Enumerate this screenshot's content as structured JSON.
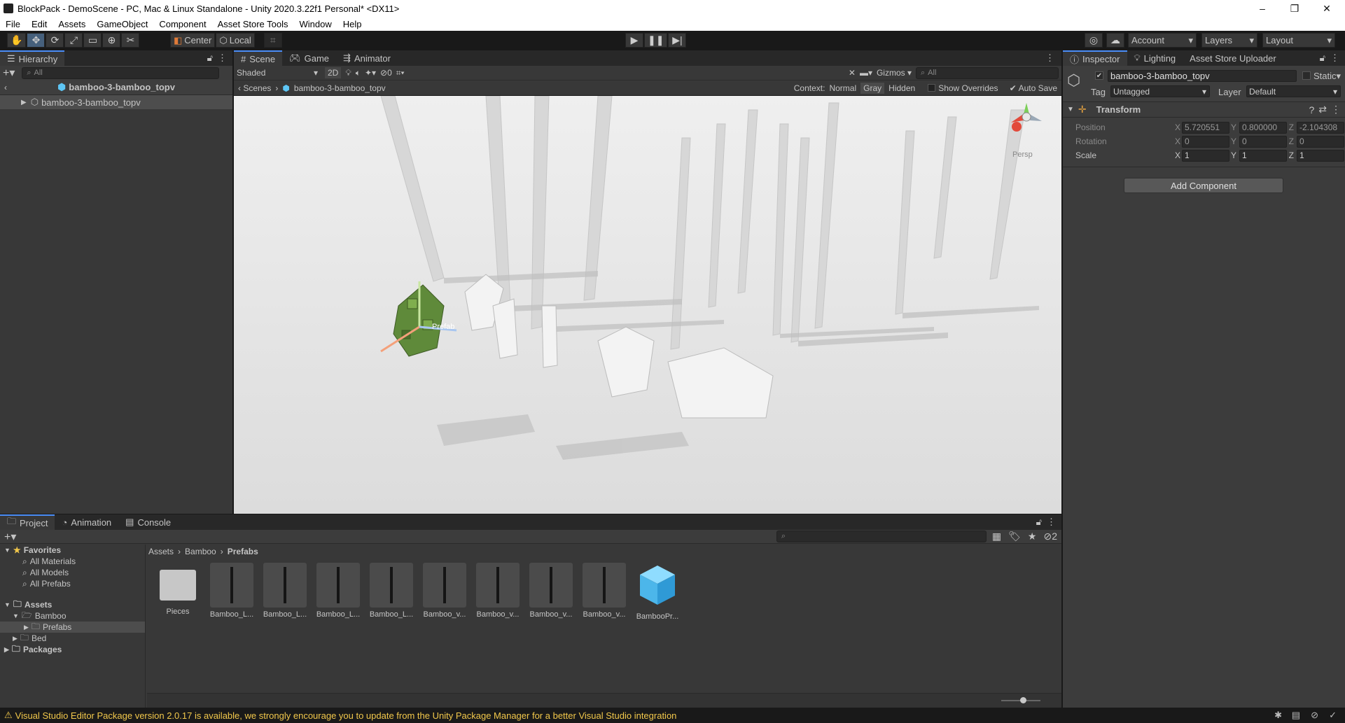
{
  "window": {
    "title": "BlockPack - DemoScene - PC, Mac & Linux Standalone - Unity 2020.3.22f1 Personal* <DX11>",
    "controls": {
      "minimize": "–",
      "maximize": "❐",
      "close": "✕"
    }
  },
  "menu": [
    "File",
    "Edit",
    "Assets",
    "GameObject",
    "Component",
    "Asset Store Tools",
    "Window",
    "Help"
  ],
  "toolbar": {
    "pivot_label": "Center",
    "space_label": "Local",
    "account_label": "Account",
    "layers_label": "Layers",
    "layout_label": "Layout"
  },
  "hierarchy": {
    "tab": "Hierarchy",
    "search_placeholder": "All",
    "breadcrumb_title": "bamboo-3-bamboo_topv",
    "items": [
      {
        "label": "bamboo-3-bamboo_topv"
      }
    ]
  },
  "scene": {
    "tabs": [
      "Scene",
      "Game",
      "Animator"
    ],
    "shading_mode": "Shaded",
    "mode_2d": "2D",
    "hidden_count": "0",
    "gizmos_label": "Gizmos",
    "search_placeholder": "All",
    "breadcrumb": {
      "root": "Scenes",
      "current": "bamboo-3-bamboo_topv"
    },
    "context": {
      "label": "Context:",
      "normal": "Normal",
      "gray": "Gray",
      "hidden": "Hidden"
    },
    "show_overrides": "Show Overrides",
    "auto_save": "Auto Save",
    "persp_label": "Persp",
    "handle_label": "Prefab"
  },
  "inspector": {
    "tabs": [
      "Inspector",
      "Lighting",
      "Asset Store Uploader"
    ],
    "object_name": "bamboo-3-bamboo_topv",
    "static_label": "Static",
    "tag_label": "Tag",
    "tag_value": "Untagged",
    "layer_label": "Layer",
    "layer_value": "Default",
    "component_title": "Transform",
    "position": {
      "label": "Position",
      "x": "5.720551",
      "y": "0.800000",
      "z": "-2.104308"
    },
    "rotation": {
      "label": "Rotation",
      "x": "0",
      "y": "0",
      "z": "0"
    },
    "scale": {
      "label": "Scale",
      "x": "1",
      "y": "1",
      "z": "1"
    },
    "axis": {
      "x": "X",
      "y": "Y",
      "z": "Z"
    },
    "add_component": "Add Component"
  },
  "project": {
    "tabs": [
      "Project",
      "Animation",
      "Console"
    ],
    "favorites_label": "Favorites",
    "favorites": [
      "All Materials",
      "All Models",
      "All Prefabs"
    ],
    "assets_label": "Assets",
    "folders": {
      "bamboo": "Bamboo",
      "prefabs": "Prefabs",
      "bed": "Bed"
    },
    "packages_label": "Packages",
    "breadcrumb": [
      "Assets",
      "Bamboo",
      "Prefabs"
    ],
    "hidden_count": "2",
    "assets": [
      "Pieces",
      "Bamboo_L...",
      "Bamboo_L...",
      "Bamboo_L...",
      "Bamboo_L...",
      "Bamboo_v...",
      "Bamboo_v...",
      "Bamboo_v...",
      "Bamboo_v...",
      "BambooPr..."
    ]
  },
  "status": {
    "message": "Visual Studio Editor Package version 2.0.17 is available, we strongly encourage you to update from the Unity Package Manager for a better Visual Studio integration"
  },
  "colors": {
    "accent": "#4a8df7",
    "selection": "#46607c",
    "warning": "#f2c84b",
    "prefab_cube": "#5ec6f5"
  }
}
